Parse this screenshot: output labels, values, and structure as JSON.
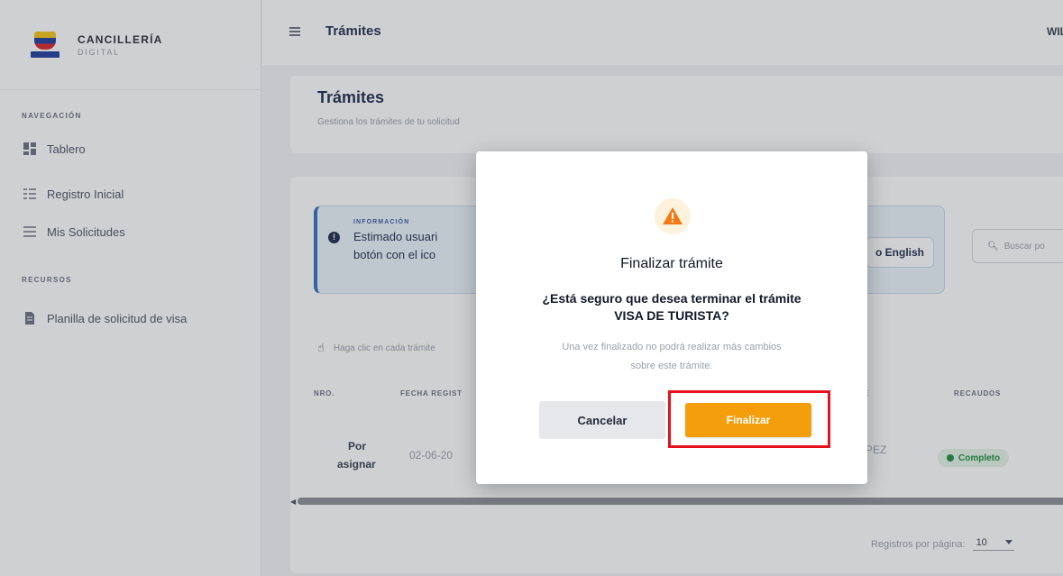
{
  "brand": {
    "name": "CANCILLERÍA",
    "subtitle": "DIGITAL"
  },
  "sidebar": {
    "nav_section": "NAVEGACIÓN",
    "nav_items": [
      {
        "label": "Tablero",
        "icon": "dashboard-icon"
      },
      {
        "label": "Registro Inicial",
        "icon": "form-icon"
      },
      {
        "label": "Mis Solicitudes",
        "icon": "list-icon"
      }
    ],
    "resources_section": "RECURSOS",
    "resource_items": [
      {
        "label": "Planilla de solicitud de visa",
        "icon": "document-icon"
      }
    ]
  },
  "topbar": {
    "title": "Trámites",
    "user": "WIL"
  },
  "page": {
    "title": "Trámites",
    "subtitle": "Gestiona los trámites de tu solicitud"
  },
  "info": {
    "label": "INFORMACIÓN",
    "line1": "Estimado usuari",
    "line2": "botón con el ico",
    "english_button": "o English"
  },
  "search": {
    "placeholder": "Buscar po"
  },
  "hint": "Haga clic en cada trámite",
  "table": {
    "headers": [
      "NRO.",
      "FECHA REGIST",
      "E",
      "RECAUDOS"
    ],
    "row": {
      "nro_line1": "Por",
      "nro_line2": "asignar",
      "fecha": "02-06-20",
      "name": "PEZ",
      "status": "Completo"
    }
  },
  "pager": {
    "label": "Registros por página:",
    "value": "10"
  },
  "modal": {
    "icon": "warning-icon",
    "title": "Finalizar trámite",
    "question_line1": "¿Está seguro que desea terminar el trámite",
    "question_line2": "VISA DE TURISTA?",
    "desc_line1": "Una vez finalizado no podrá realizar más cambios",
    "desc_line2": "sobre este trámite.",
    "cancel_label": "Cancelar",
    "confirm_label": "Finalizar"
  },
  "colors": {
    "accent": "#f59e0b",
    "highlight": "#e8101a",
    "navy": "#1f2d4e"
  }
}
